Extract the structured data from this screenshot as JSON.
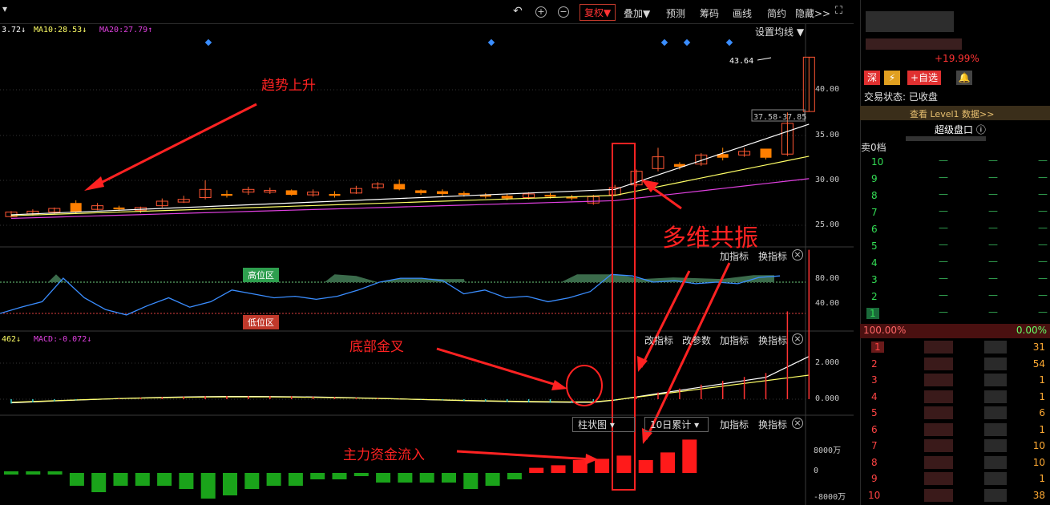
{
  "toolbar": {
    "undo_icon": "undo-icon",
    "zoom_in_icon": "zoom-in-icon",
    "zoom_out_icon": "zoom-out-icon",
    "fuquan": "复权▼",
    "overlay": "叠加▼",
    "forecast": "预测",
    "chips": "筹码",
    "draw": "画线",
    "simple": "简约",
    "hide": "隐藏>>",
    "fullscreen_icon": "fullscreen-icon"
  },
  "ma": {
    "ma5": "3.72↓",
    "ma10": "MA10:28.53↓",
    "ma20": "MA20:27.79↑",
    "settings": "设置均线 ▼"
  },
  "price_panel": {
    "axis": [
      "40.00",
      "35.00",
      "30.00",
      "25.00"
    ],
    "high_label": "43.64",
    "range_label": "37.58-37.85"
  },
  "rsi_panel": {
    "high_zone": "高位区",
    "low_zone": "低位区",
    "axis": [
      "80.00",
      "40.00"
    ],
    "add_indicator": "加指标",
    "switch_indicator": "换指标"
  },
  "macd_panel": {
    "dif": "462↓",
    "macd": "MACD:-0.072↓",
    "change_indicator": "改指标",
    "change_params": "改参数",
    "add_indicator": "加指标",
    "switch_indicator": "换指标",
    "axis": [
      "2.000",
      "0.000"
    ]
  },
  "flow_panel": {
    "chart_type": "柱状图",
    "period": "10日累计",
    "add_indicator": "加指标",
    "switch_indicator": "换指标",
    "axis": [
      "8000万",
      "0",
      "-8000万"
    ]
  },
  "annotations": {
    "trend": "趋势上升",
    "resonance": "多维共振",
    "golden_cross": "底部金叉",
    "inflow": "主力资金流入"
  },
  "quote": {
    "change_pct": "+19.99%",
    "exchange_badge": "深",
    "add_watchlist": "+自选",
    "trade_status": "交易状态: 已收盘",
    "level1": "查看 Level1 数据>>",
    "super_panel": "超级盘口",
    "sell_header": "卖0档",
    "buy_pct": "100.00%",
    "sell_pct": "0.00%",
    "sell_levels": [
      "10",
      "9",
      "8",
      "7",
      "6",
      "5",
      "4",
      "3",
      "2",
      "1"
    ],
    "buy_levels": [
      {
        "n": "1",
        "v": "31"
      },
      {
        "n": "2",
        "v": "54"
      },
      {
        "n": "3",
        "v": "1"
      },
      {
        "n": "4",
        "v": "1"
      },
      {
        "n": "5",
        "v": "6"
      },
      {
        "n": "6",
        "v": "1"
      },
      {
        "n": "7",
        "v": "10"
      },
      {
        "n": "8",
        "v": "10"
      },
      {
        "n": "9",
        "v": "1"
      },
      {
        "n": "10",
        "v": "38"
      }
    ]
  },
  "colors": {
    "up": "#ff3333",
    "down": "#00b050",
    "ma10": "#ffff66",
    "ma20": "#e040e0",
    "accent": "#ff2222"
  }
}
